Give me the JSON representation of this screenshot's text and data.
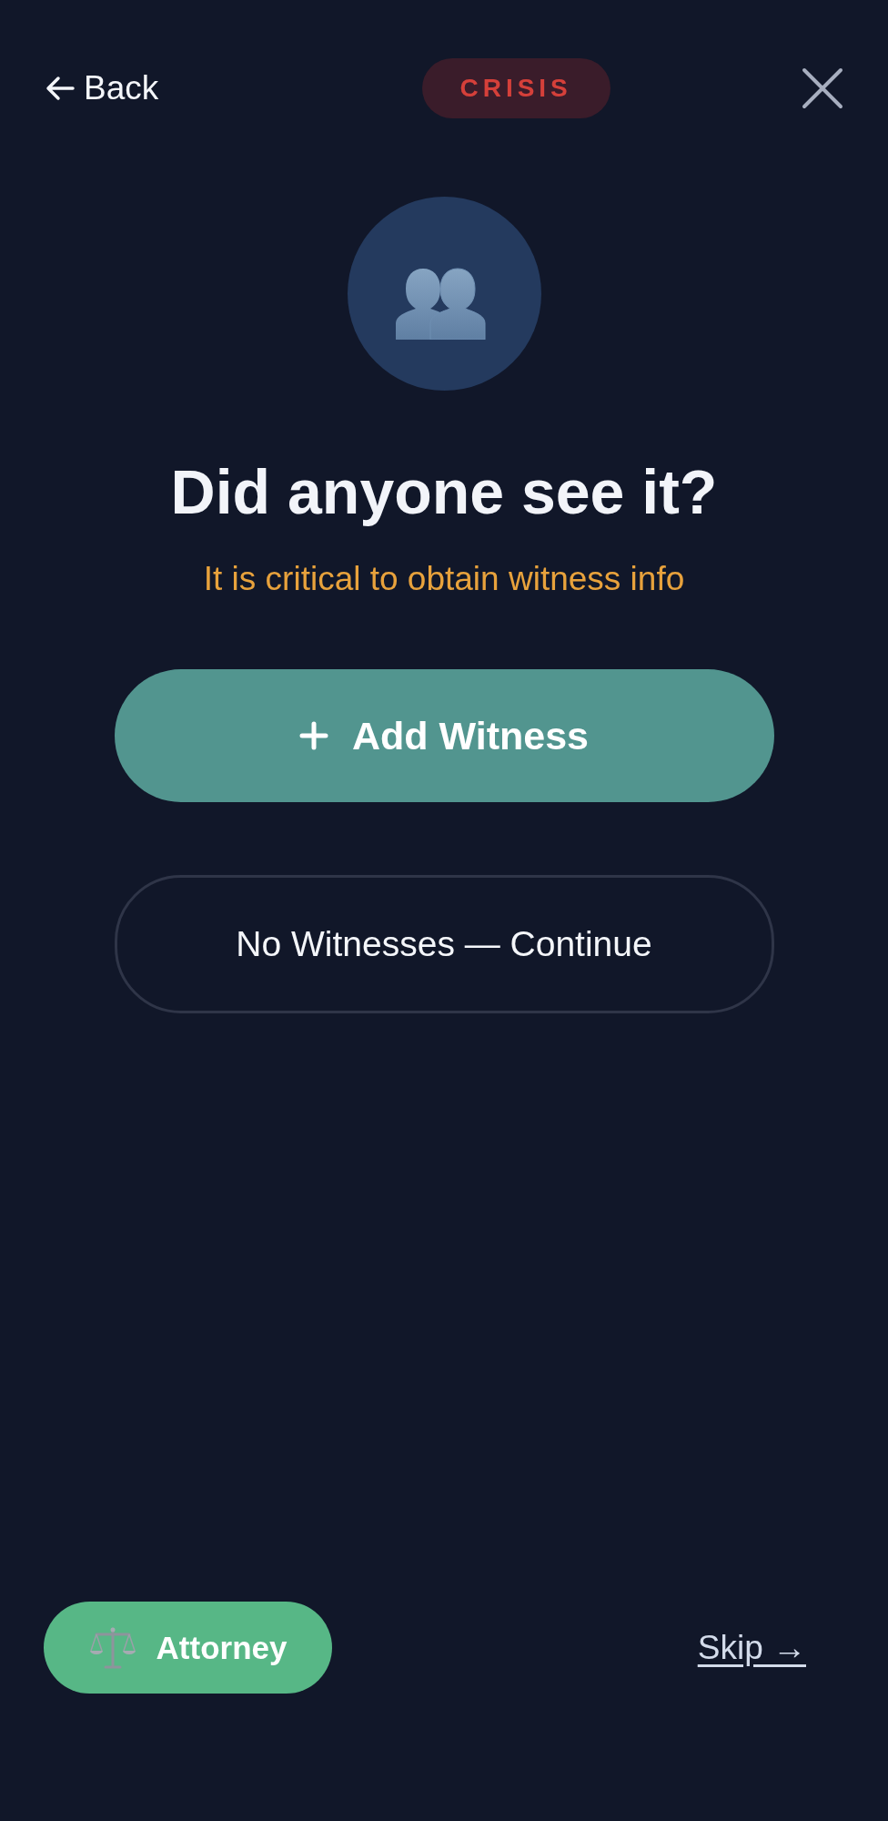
{
  "header": {
    "back": "Back",
    "badge": "CRISIS"
  },
  "prompt": {
    "title": "Did anyone see it?",
    "subtitle": "It is critical to obtain witness info"
  },
  "actions": [
    {
      "label": "Add Witness",
      "kind": "primary"
    },
    {
      "label": "No Witnesses — Continue",
      "kind": "secondary"
    }
  ],
  "footer": {
    "attorney": "Attorney",
    "skip": "Skip →"
  }
}
